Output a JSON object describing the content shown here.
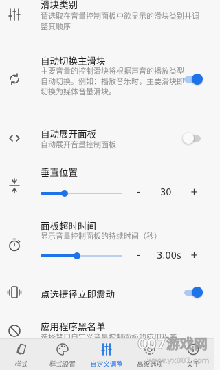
{
  "settings": {
    "slider_types": {
      "title": "滑块类别",
      "description": "请选取在音量控制面板中欲显示的滑块类别并调整其顺序",
      "icon": "sliders-icon"
    },
    "auto_switch": {
      "title": "自动切换主滑块",
      "description": "主要音量的控制滑块将根据声音的播放类型自动切换。例如：播放音乐时，主要滑块即切换为媒体音量滑块。",
      "icon": "sync-icon",
      "enabled": true
    },
    "auto_expand": {
      "title": "自动展开面板",
      "description": "自动展开音量控制面板",
      "icon": "code-brackets-icon",
      "enabled": false
    },
    "vertical_position": {
      "title": "垂直位置",
      "icon": "vertical-align-icon",
      "minus": "-",
      "value": "30",
      "plus": "+",
      "level": 0.3
    },
    "panel_timeout": {
      "title": "面板超时时间",
      "description": "显示音量控制面板的持续时间（秒）",
      "icon": "timer-icon",
      "minus": "-",
      "value": "3.00s",
      "plus": "+",
      "level": 0.45
    },
    "vibrate": {
      "title": "点选捷径立即震动",
      "icon": "vibrate-icon",
      "enabled": true
    },
    "blacklist": {
      "title": "应用程序黑名单",
      "description": "选择禁用自定义音量控制面板的应用程序",
      "icon": "block-icon"
    }
  },
  "bottom_nav": [
    {
      "label": "样式",
      "icon": "style-icon",
      "active": false
    },
    {
      "label": "样式设置",
      "icon": "palette-icon",
      "active": false
    },
    {
      "label": "自定义调整",
      "icon": "tune-icon",
      "active": true
    },
    {
      "label": "高级选项",
      "icon": "advanced-icon",
      "active": false
    },
    {
      "label": "关于",
      "icon": "info-icon",
      "active": false
    }
  ],
  "watermark": {
    "line1": "007游戏网",
    "line2": "www.yx007.com"
  },
  "colors": {
    "accent": "#1f73e8",
    "accent_light": "#a9c9f6",
    "background": "#f7f7f7",
    "text": "#1d1d1d",
    "secondary_text": "#8f8f8f"
  }
}
